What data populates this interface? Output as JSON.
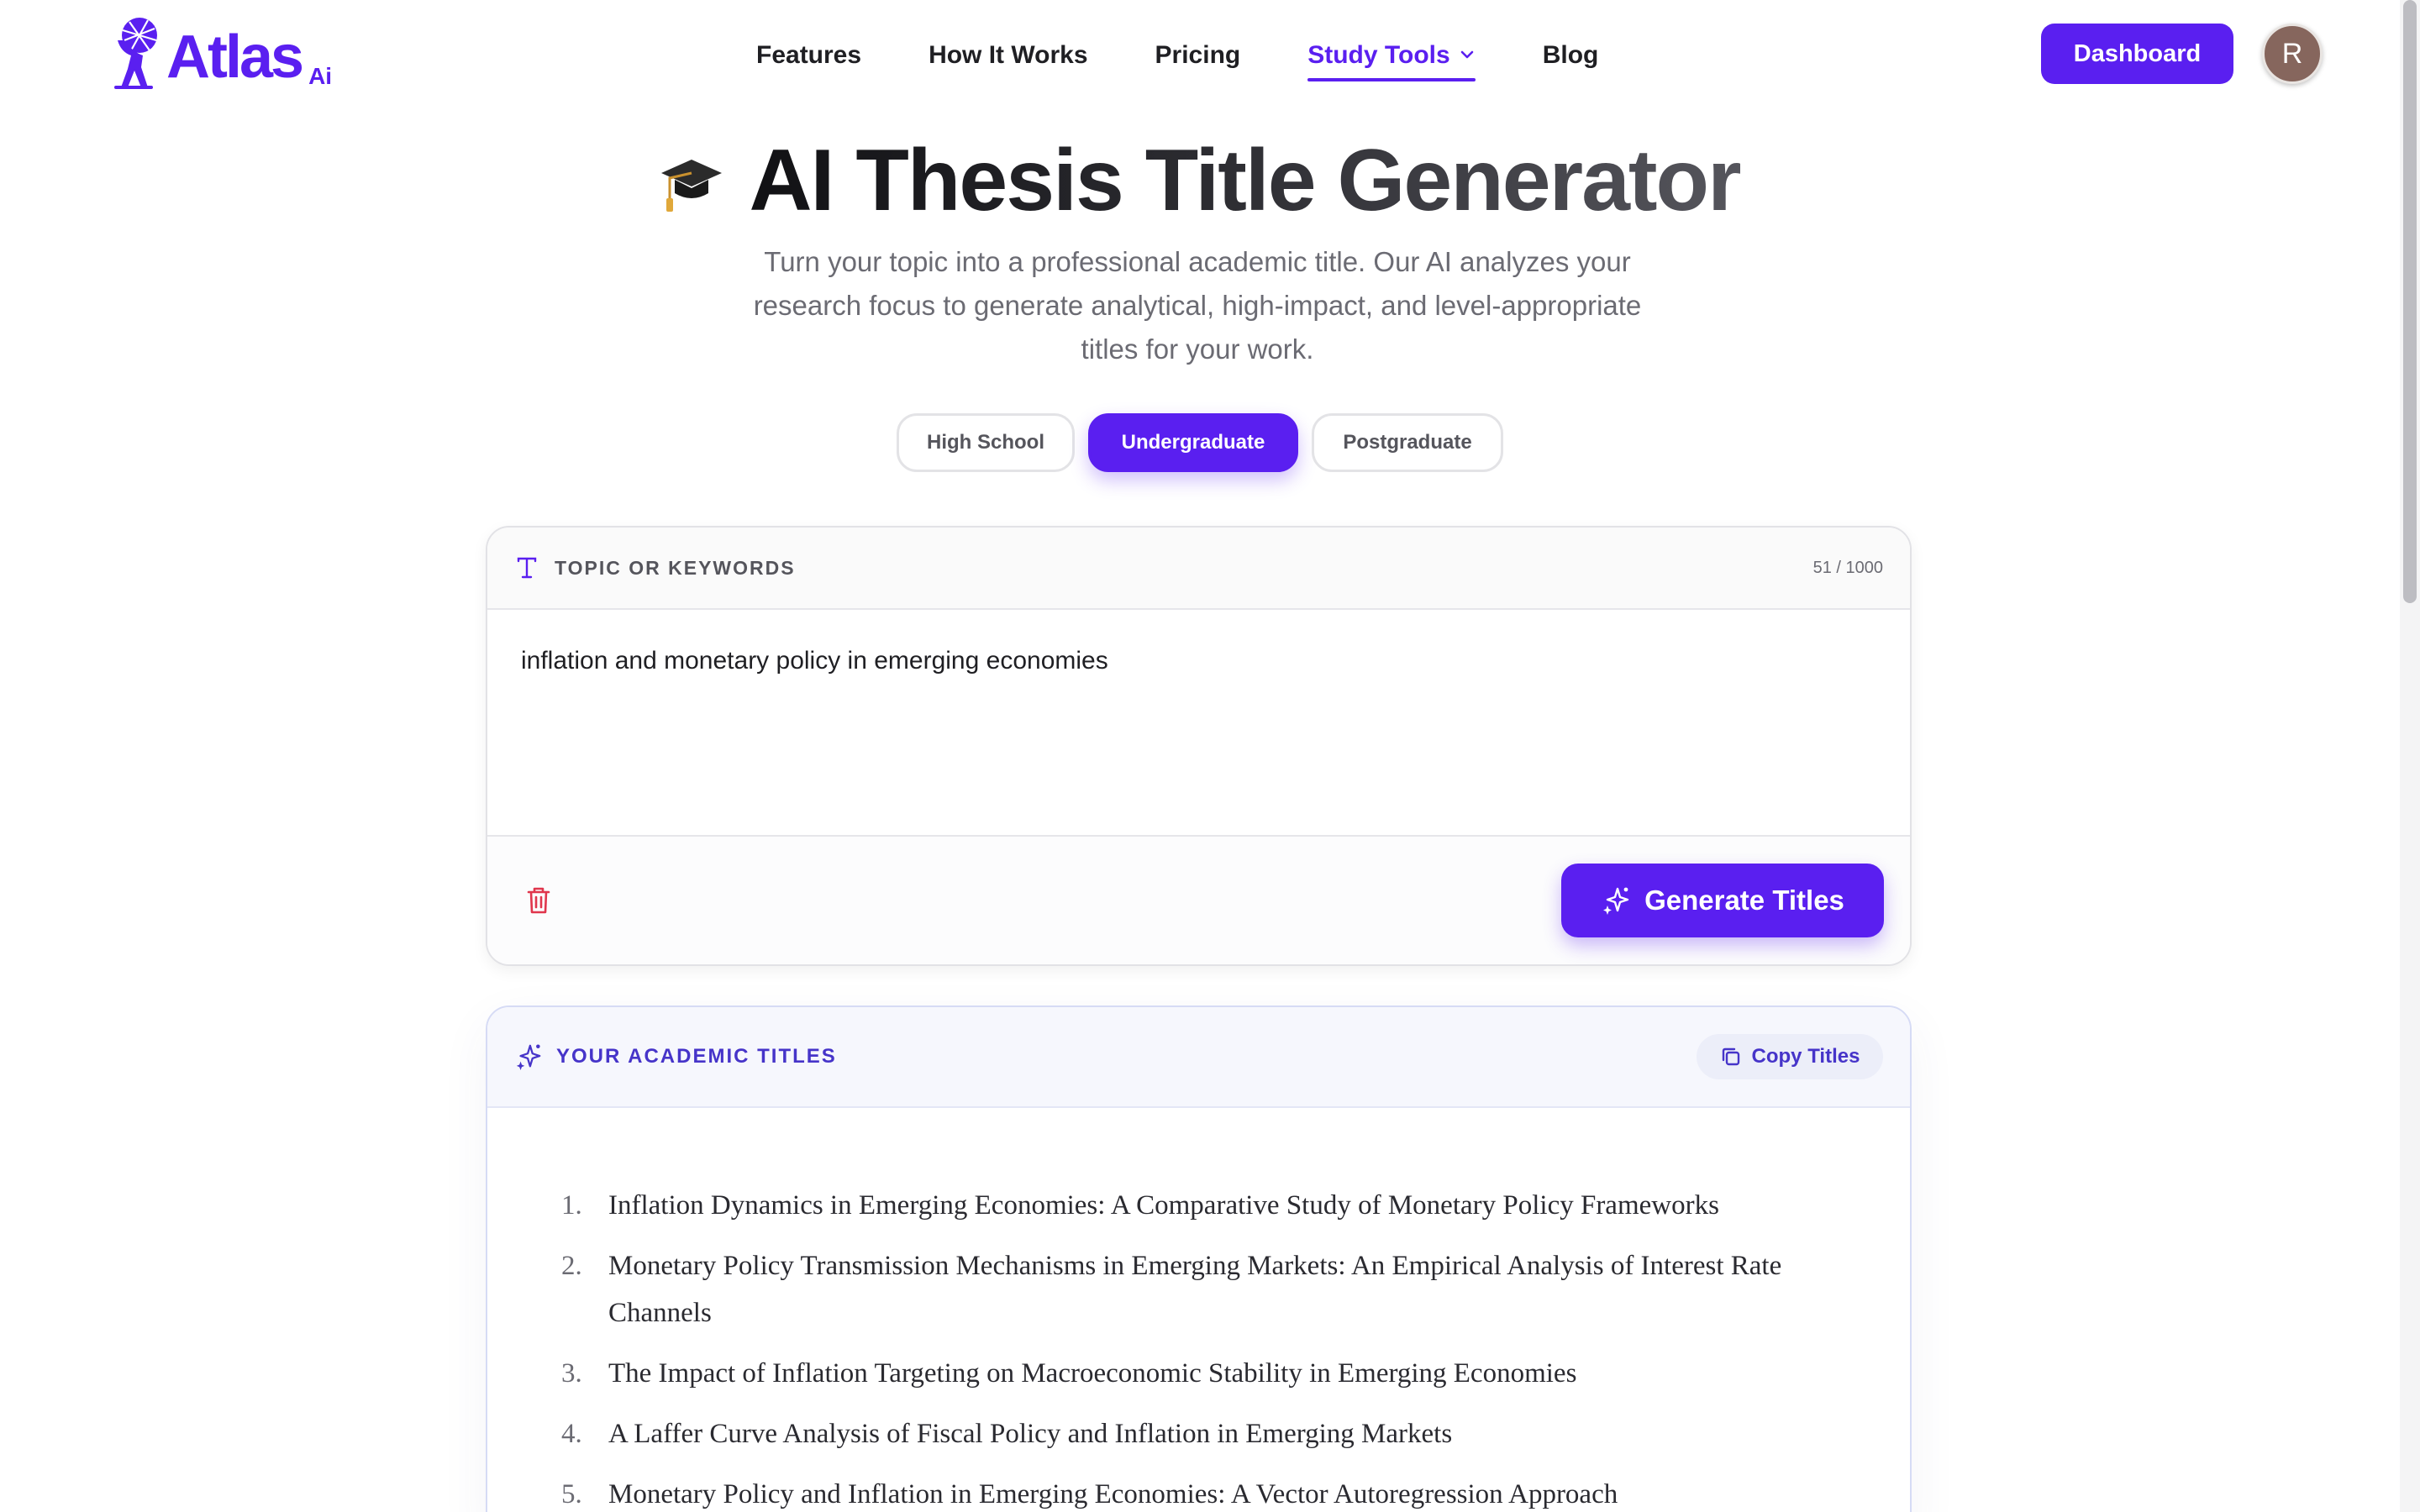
{
  "brand": {
    "name": "Atlas",
    "suffix": "Ai"
  },
  "nav": {
    "items": [
      {
        "label": "Features"
      },
      {
        "label": "How It Works"
      },
      {
        "label": "Pricing"
      },
      {
        "label": "Study Tools"
      },
      {
        "label": "Blog"
      }
    ],
    "active": "Study Tools"
  },
  "header": {
    "dashboard_label": "Dashboard",
    "avatar_initial": "R"
  },
  "hero": {
    "title": "AI Thesis Title Generator",
    "subtitle": "Turn your topic into a professional academic title. Our AI analyzes your research focus to generate analytical, high-impact, and level-appropriate titles for your work."
  },
  "levels": {
    "options": [
      "High School",
      "Undergraduate",
      "Postgraduate"
    ],
    "selected": "Undergraduate"
  },
  "input_card": {
    "label": "TOPIC OR KEYWORDS",
    "count": "51 / 1000",
    "value": "inflation and monetary policy in emerging economies",
    "generate_label": "Generate Titles"
  },
  "results": {
    "label": "YOUR ACADEMIC TITLES",
    "copy_label": "Copy Titles",
    "titles": [
      {
        "num": "1.",
        "text": "Inflation Dynamics in Emerging Economies: A Comparative Study of Monetary Policy Frameworks"
      },
      {
        "num": "2.",
        "text": "Monetary Policy Transmission Mechanisms in Emerging Markets: An Empirical Analysis of Interest Rate Channels"
      },
      {
        "num": "3.",
        "text": "The Impact of Inflation Targeting on Macroeconomic Stability in Emerging Economies"
      },
      {
        "num": "4.",
        "text": "A Laffer Curve Analysis of Fiscal Policy and Inflation in Emerging Markets"
      },
      {
        "num": "5.",
        "text": "Monetary Policy and Inflation in Emerging Economies: A Vector Autoregression Approach"
      }
    ]
  },
  "colors": {
    "accent": "#5a1ff0",
    "results_accent": "#4634c9",
    "danger": "#e0364d"
  },
  "icons": {
    "logo": "atlas-globe-figure-icon",
    "hero": "graduation-cap-icon",
    "input_head": "text-t-icon",
    "clear": "trash-icon",
    "generate": "sparkles-icon",
    "results_head": "sparkles-icon",
    "copy": "copy-icon",
    "nav_dropdown": "chevron-down-icon"
  }
}
